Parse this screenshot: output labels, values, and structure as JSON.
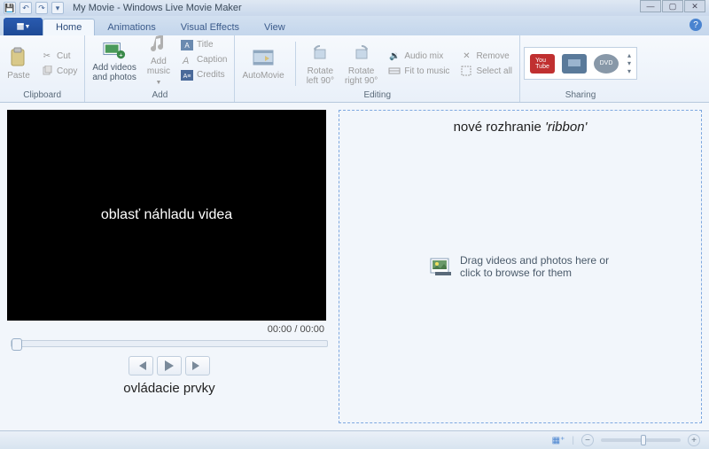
{
  "title": "My Movie - Windows Live Movie Maker",
  "tabs": {
    "home": "Home",
    "animations": "Animations",
    "visualEffects": "Visual Effects",
    "view": "View"
  },
  "ribbon": {
    "clipboard": {
      "label": "Clipboard",
      "paste": "Paste",
      "cut": "Cut",
      "copy": "Copy"
    },
    "add": {
      "label": "Add",
      "addVideos": "Add videos\nand photos",
      "addMusic": "Add\nmusic",
      "title": "Title",
      "caption": "Caption",
      "credits": "Credits"
    },
    "automovie": "AutoMovie",
    "editing": {
      "label": "Editing",
      "rotateLeft": "Rotate\nleft 90°",
      "rotateRight": "Rotate\nright 90°",
      "audioMix": "Audio mix",
      "fitToMusic": "Fit to music",
      "remove": "Remove",
      "selectAll": "Select all"
    },
    "sharing": {
      "label": "Sharing"
    }
  },
  "preview": {
    "overlay": "oblasť náhladu videa",
    "time": "00:00 / 00:00",
    "controlsLabel": "ovládacie prvky"
  },
  "storyboard": {
    "ribbonNote": "nové rozhranie ",
    "ribbonNoteItalic": "'ribbon'",
    "dropHint": "Drag videos and photos here or click to browse for them"
  }
}
